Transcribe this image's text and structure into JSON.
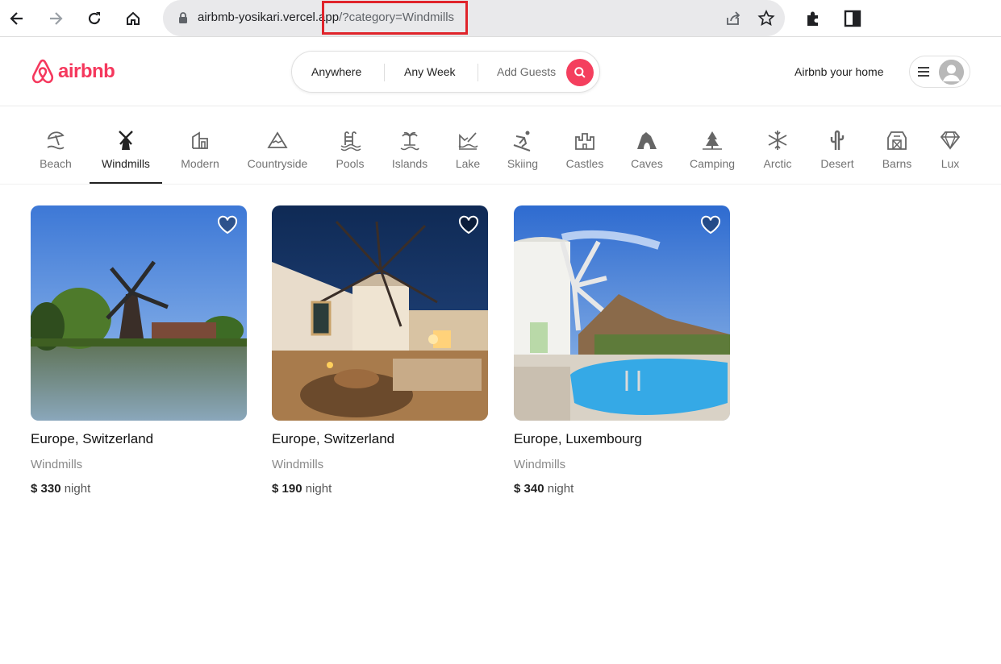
{
  "browser": {
    "url_host": "airbmb-yosikari.vercel.app",
    "url_path": "/?category=Windmills"
  },
  "header": {
    "logo_text": "airbnb",
    "search": {
      "where": "Anywhere",
      "when": "Any Week",
      "guests": "Add Guests"
    },
    "host_link": "Airbnb your home"
  },
  "categories": [
    {
      "label": "Beach",
      "icon": "beach-umbrella-icon"
    },
    {
      "label": "Windmills",
      "icon": "windmill-icon",
      "active": true
    },
    {
      "label": "Modern",
      "icon": "modern-house-icon"
    },
    {
      "label": "Countryside",
      "icon": "mountain-icon"
    },
    {
      "label": "Pools",
      "icon": "pool-icon"
    },
    {
      "label": "Islands",
      "icon": "island-icon"
    },
    {
      "label": "Lake",
      "icon": "lake-icon"
    },
    {
      "label": "Skiing",
      "icon": "skiing-icon"
    },
    {
      "label": "Castles",
      "icon": "castle-icon"
    },
    {
      "label": "Caves",
      "icon": "cave-icon"
    },
    {
      "label": "Camping",
      "icon": "camping-icon"
    },
    {
      "label": "Arctic",
      "icon": "snowflake-icon"
    },
    {
      "label": "Desert",
      "icon": "cactus-icon"
    },
    {
      "label": "Barns",
      "icon": "barn-icon"
    },
    {
      "label": "Lux",
      "icon": "diamond-icon"
    }
  ],
  "listings": [
    {
      "location": "Europe, Switzerland",
      "category": "Windmills",
      "price": "$ 330",
      "unit": "night"
    },
    {
      "location": "Europe, Switzerland",
      "category": "Windmills",
      "price": "$ 190",
      "unit": "night"
    },
    {
      "location": "Europe, Luxembourg",
      "category": "Windmills",
      "price": "$ 340",
      "unit": "night"
    }
  ],
  "colors": {
    "brand": "#f43f5e",
    "highlight": "#e0242b"
  }
}
